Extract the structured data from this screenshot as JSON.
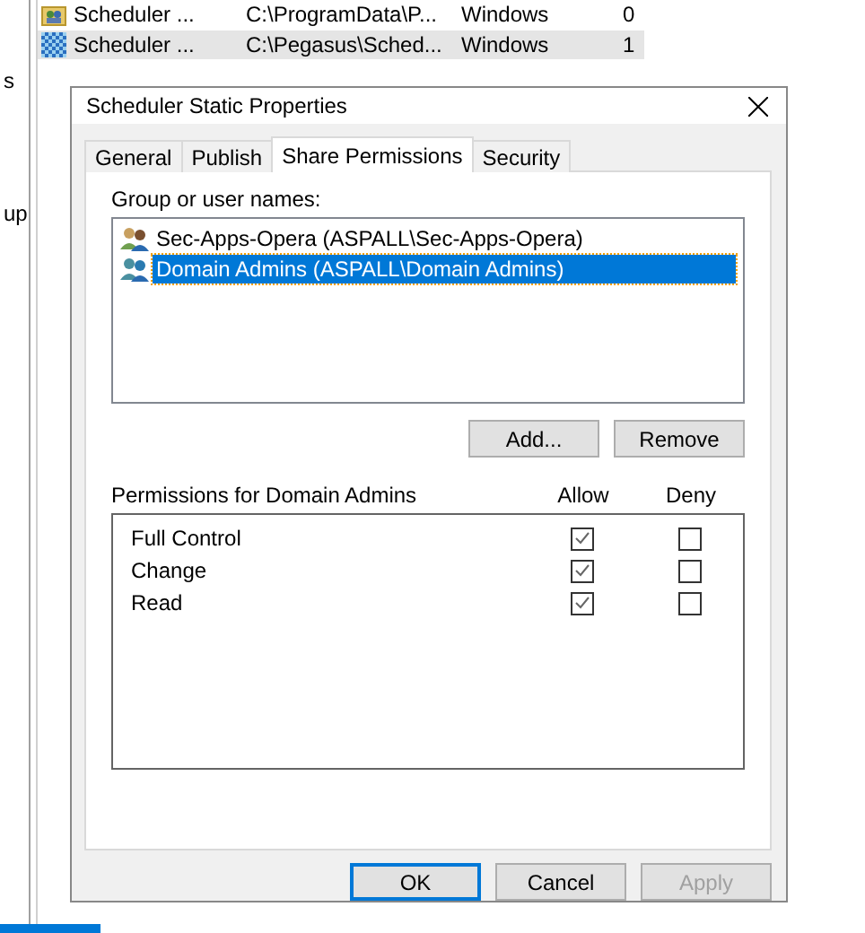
{
  "background_list": {
    "rows": [
      {
        "name": "Scheduler ...",
        "path": "C:\\ProgramData\\P...",
        "type": "Windows",
        "count": "0",
        "kind": "folder",
        "selected": false
      },
      {
        "name": "Scheduler ...",
        "path": "C:\\Pegasus\\Sched...",
        "type": "Windows",
        "count": "1",
        "kind": "grid",
        "selected": true
      }
    ],
    "left_fragments": [
      "s",
      "up"
    ]
  },
  "dialog": {
    "title": "Scheduler Static Properties",
    "tabs": [
      {
        "label": "General",
        "selected": false
      },
      {
        "label": "Publish",
        "selected": false
      },
      {
        "label": "Share Permissions",
        "selected": true
      },
      {
        "label": "Security",
        "selected": false
      }
    ],
    "group_label": "Group or user names:",
    "users": [
      {
        "name": "Sec-Apps-Opera (ASPALL\\Sec-Apps-Opera)",
        "selected": false
      },
      {
        "name": "Domain Admins (ASPALL\\Domain Admins)",
        "selected": true
      }
    ],
    "user_buttons": [
      "Add...",
      "Remove"
    ],
    "permissions_label": "Permissions for Domain Admins",
    "columns": [
      "Allow",
      "Deny"
    ],
    "permissions": [
      {
        "name": "Full Control",
        "allow": true,
        "deny": false
      },
      {
        "name": "Change",
        "allow": true,
        "deny": false
      },
      {
        "name": "Read",
        "allow": true,
        "deny": false
      }
    ],
    "buttons": [
      {
        "label": "OK",
        "default": true,
        "disabled": false
      },
      {
        "label": "Cancel",
        "default": false,
        "disabled": false
      },
      {
        "label": "Apply",
        "default": false,
        "disabled": true
      }
    ]
  }
}
